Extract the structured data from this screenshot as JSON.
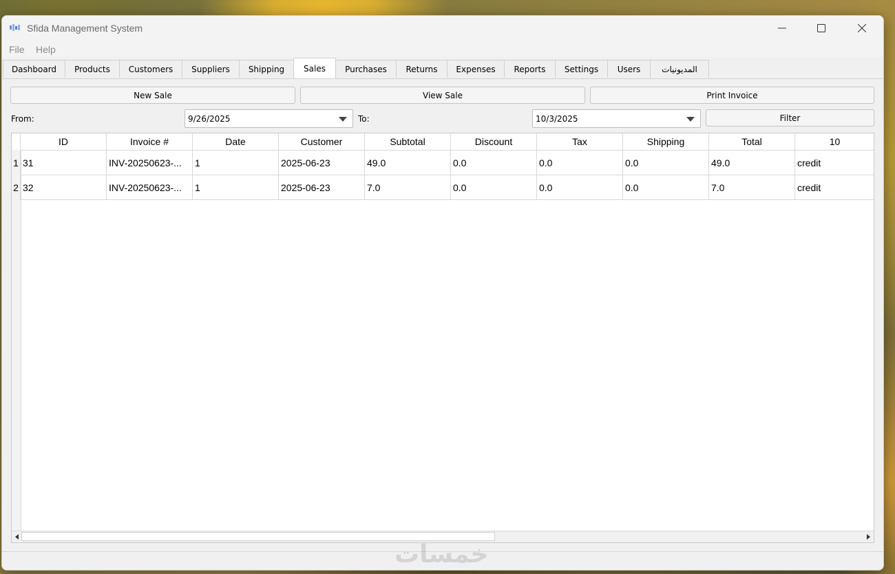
{
  "window": {
    "title": "Sfida Management System"
  },
  "menu": [
    "File",
    "Help"
  ],
  "tabs": [
    {
      "label": "Dashboard",
      "active": false
    },
    {
      "label": "Products",
      "active": false
    },
    {
      "label": "Customers",
      "active": false
    },
    {
      "label": "Suppliers",
      "active": false
    },
    {
      "label": "Shipping",
      "active": false
    },
    {
      "label": "Sales",
      "active": true
    },
    {
      "label": "Purchases",
      "active": false
    },
    {
      "label": "Returns",
      "active": false
    },
    {
      "label": "Expenses",
      "active": false
    },
    {
      "label": "Reports",
      "active": false
    },
    {
      "label": "Settings",
      "active": false
    },
    {
      "label": "Users",
      "active": false
    },
    {
      "label": "المديونيات",
      "active": false
    }
  ],
  "actions": {
    "new_sale": "New Sale",
    "view_sale": "View Sale",
    "print_invoice": "Print Invoice",
    "filter": "Filter"
  },
  "filter": {
    "from_label": "From:",
    "from_value": "9/26/2025",
    "to_label": "To:",
    "to_value": "10/3/2025"
  },
  "table": {
    "columns": [
      "ID",
      "Invoice #",
      "Date",
      "Customer",
      "Subtotal",
      "Discount",
      "Tax",
      "Shipping",
      "Total",
      "10"
    ],
    "rows": [
      {
        "num": "1",
        "cells": [
          "31",
          "INV-20250623-...",
          "1",
          "2025-06-23",
          "49.0",
          "0.0",
          "0.0",
          "0.0",
          "49.0",
          "credit"
        ]
      },
      {
        "num": "2",
        "cells": [
          "32",
          "INV-20250623-...",
          "1",
          "2025-06-23",
          "7.0",
          "0.0",
          "0.0",
          "0.0",
          "7.0",
          "credit"
        ]
      }
    ]
  },
  "watermark": "خمسات"
}
